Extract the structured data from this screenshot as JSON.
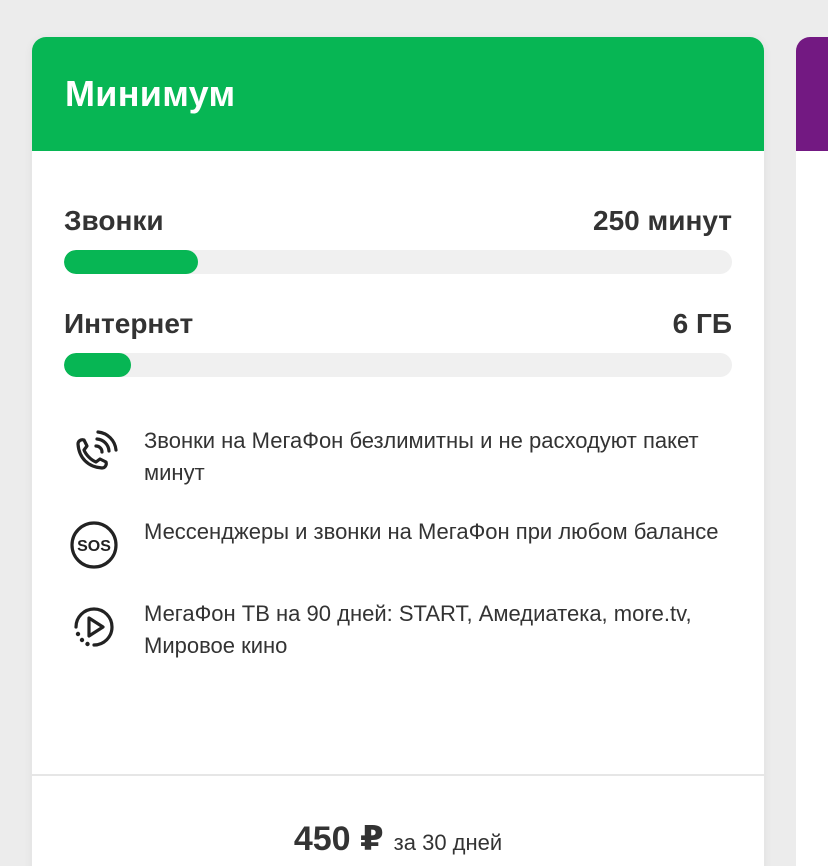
{
  "tariff": {
    "title": "Минимум",
    "header_color": "#07b654",
    "next_card_color": "#731982"
  },
  "usage": [
    {
      "label": "Звонки",
      "value": "250 минут",
      "fill_fraction": 0.2
    },
    {
      "label": "Интернет",
      "value": "6 ГБ",
      "fill_fraction": 0.1
    }
  ],
  "features": [
    {
      "icon": "phone-calls-icon",
      "text": "Звонки на МегаФон безлимитны и не расходуют пакет минут"
    },
    {
      "icon": "sos-icon",
      "text": "Мессенджеры и звонки на МегаФон при любом балансе"
    },
    {
      "icon": "tv-play-icon",
      "text": "МегаФон ТВ на 90 дней: START, Амедиатека, more.tv, Мировое кино"
    }
  ],
  "price": {
    "amount": "450 ₽",
    "period": "за 30 дней"
  }
}
